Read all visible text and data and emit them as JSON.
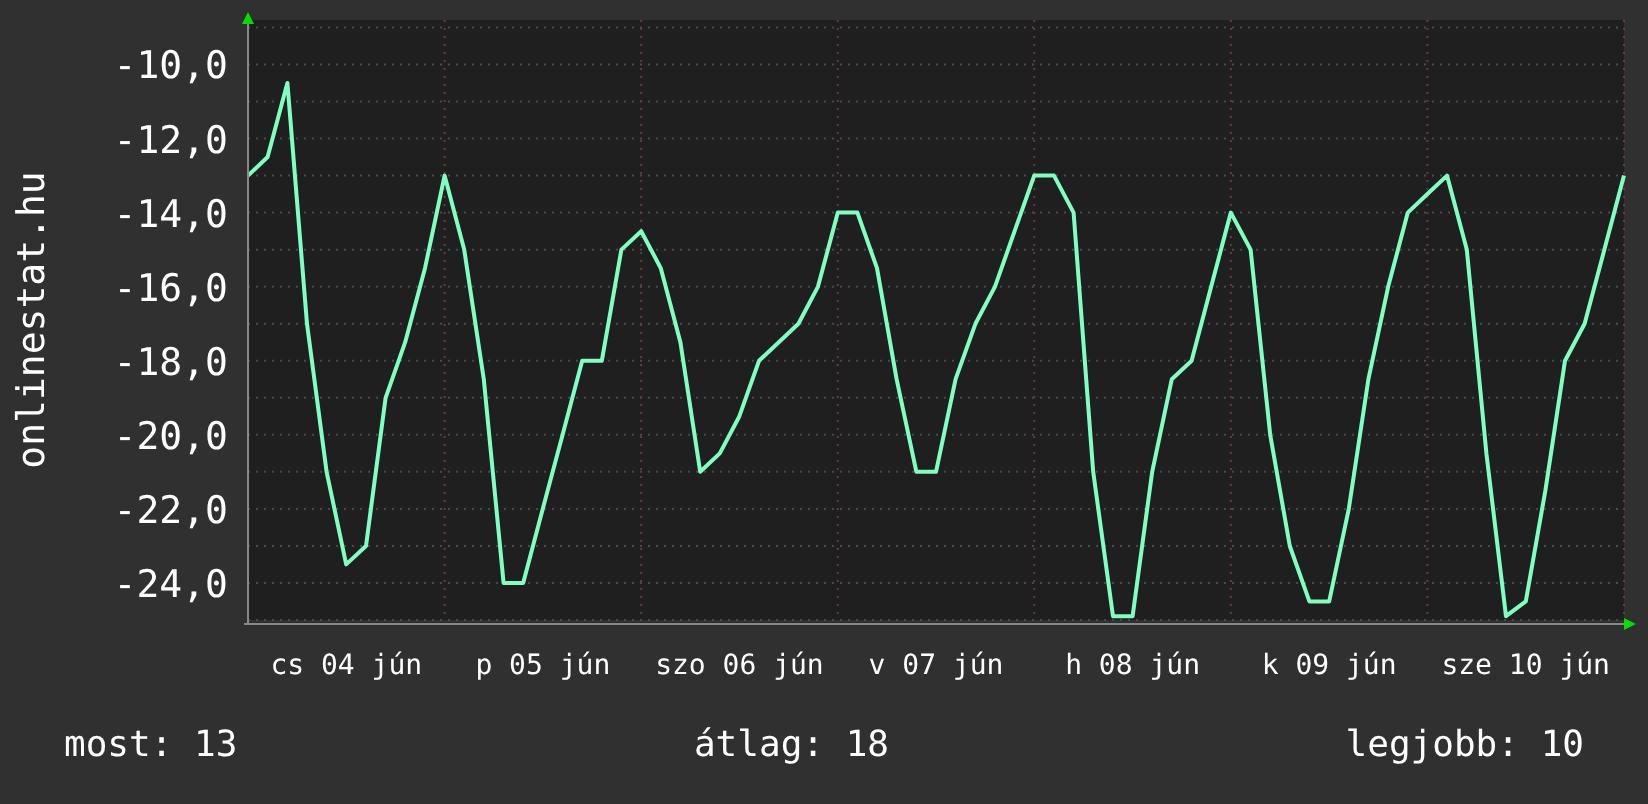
{
  "chart": {
    "chart_data": {
      "type": "line",
      "grid": true,
      "ylabel": "onlinestat.hu",
      "ylim": [
        -25,
        -8.8
      ],
      "categories": [
        null,
        null,
        null,
        null,
        null,
        "cs 04 jún",
        null,
        null,
        null,
        null,
        null,
        null,
        null,
        null,
        null,
        "p 05 jún",
        null,
        null,
        null,
        null,
        null,
        null,
        null,
        null,
        null,
        "szo 06 jún",
        null,
        null,
        null,
        null,
        null,
        null,
        null,
        null,
        null,
        "v 07 jún",
        null,
        null,
        null,
        null,
        null,
        null,
        null,
        null,
        null,
        "h 08 jún",
        null,
        null,
        null,
        null,
        null,
        null,
        null,
        null,
        null,
        "k 09 jún",
        null,
        null,
        null,
        null,
        null,
        null,
        null,
        null,
        null,
        "sze 10 jún",
        null,
        null,
        null,
        null,
        null
      ],
      "yticks": [
        {
          "value": -10,
          "label": "-10,0"
        },
        {
          "value": -12,
          "label": "-12,0"
        },
        {
          "value": -14,
          "label": "-14,0"
        },
        {
          "value": -16,
          "label": "-16,0"
        },
        {
          "value": -18,
          "label": "-18,0"
        },
        {
          "value": -20,
          "label": "-20,0"
        },
        {
          "value": -22,
          "label": "-22,0"
        },
        {
          "value": -24,
          "label": "-24,0"
        }
      ],
      "series": [
        {
          "color": "#7fffc0",
          "values": [
            -13,
            -12.5,
            -10.5,
            -17,
            -21,
            -23.5,
            -23,
            -19,
            -17.5,
            -15.5,
            -13,
            -15,
            -18.5,
            -24,
            -24,
            -22,
            -20,
            -18,
            -18,
            -15,
            -14.5,
            -15.5,
            -17.5,
            -21,
            -20.5,
            -19.5,
            -18,
            -17.5,
            -17,
            -16,
            -14,
            -14,
            -15.5,
            -18.5,
            -21,
            -21,
            -18.5,
            -17,
            -16,
            -14.5,
            -13,
            -13,
            -14,
            -21,
            -24.9,
            -24.9,
            -21,
            -18.5,
            -18,
            -16,
            -14,
            -15,
            -20,
            -23,
            -24.5,
            -24.5,
            -22,
            -18.5,
            -16,
            -14,
            -13.5,
            -13,
            -15,
            -20.5,
            -24.9,
            -24.5,
            -21.5,
            -18,
            -17,
            -15,
            -13
          ]
        }
      ]
    }
  },
  "stats": [
    {
      "label": "most: 13"
    },
    {
      "label": "átlag: 18"
    },
    {
      "label": "legjobb: 10"
    }
  ]
}
